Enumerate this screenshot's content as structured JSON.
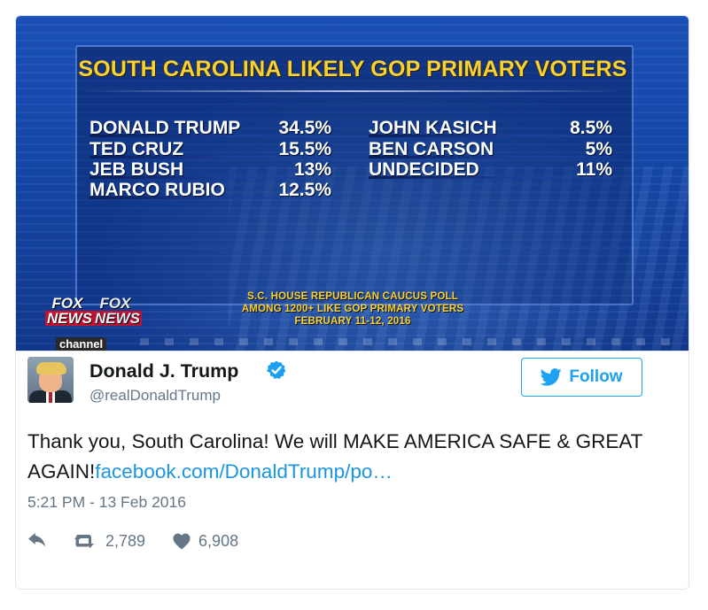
{
  "media": {
    "headline": "SOUTH CAROLINA LIKELY GOP PRIMARY VOTERS",
    "results_left": [
      {
        "name": "DONALD TRUMP",
        "pct": "34.5%"
      },
      {
        "name": "TED CRUZ",
        "pct": "15.5%"
      },
      {
        "name": "JEB BUSH",
        "pct": "13%"
      },
      {
        "name": "MARCO RUBIO",
        "pct": "12.5%"
      }
    ],
    "results_right": [
      {
        "name": "JOHN KASICH",
        "pct": "8.5%"
      },
      {
        "name": "BEN CARSON",
        "pct": "5%"
      },
      {
        "name": "UNDECIDED",
        "pct": "11%"
      }
    ],
    "source_lines": [
      "S.C. HOUSE REPUBLICAN CAUCUS POLL",
      "AMONG 1200+ LIKE GOP PRIMARY VOTERS",
      "FEBRUARY 11-12, 2016"
    ],
    "logo": {
      "fox": "FOX",
      "news": "NEWS",
      "channel": "channel"
    },
    "colors": {
      "background": "#1446a6",
      "headline": "#f4d23d",
      "text": "#ffffff"
    }
  },
  "tweet": {
    "author_name": "Donald J. Trump",
    "handle": "@realDonaldTrump",
    "verified": true,
    "follow_label": "Follow",
    "text": "Thank you, South Carolina! We will MAKE AMERICA SAFE & GREAT AGAIN!",
    "link_text": "facebook.com/DonaldTrump/po…",
    "timestamp": "5:21 PM - 13 Feb 2016",
    "retweets": "2,789",
    "likes": "6,908"
  },
  "icons": {
    "verified": "verified-badge-icon",
    "follow": "twitter-bird-icon",
    "reply": "reply-icon",
    "retweet": "retweet-icon",
    "like": "heart-icon"
  },
  "colors": {
    "accent": "#1da1f2",
    "link": "#1b95e0",
    "secondary_text": "#657786",
    "border": "#e1e8ed"
  }
}
